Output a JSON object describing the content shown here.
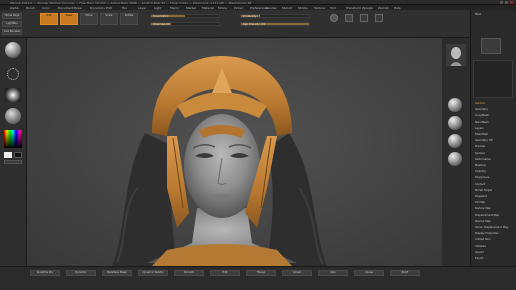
{
  "titlebar": {
    "text": "ZBrush 2021.6 — Wonder Woman (Cronos) — Free Mem 16.233 — Active Mem 3498 — Scratch Disk 53 — Timer 0.091 — PolyCount: 4.112 MP — MeshCount: 68"
  },
  "menubar": {
    "items": [
      "Alpha",
      "Brush",
      "Color",
      "Document",
      "Draw",
      "Dynamics",
      "Edit",
      "File",
      "Layer",
      "Light",
      "Macro",
      "Marker",
      "Material",
      "Movie",
      "Picker",
      "Preferences",
      "Render",
      "Stencil",
      "Stroke",
      "Texture",
      "Tool",
      "Transform",
      "Zplugin",
      "Zscript",
      "Help"
    ]
  },
  "topshelf": {
    "buttons": [
      "Home Page",
      "LightBox",
      "Live Boolean",
      "Edit",
      "Draw",
      "Move",
      "Scale",
      "Rotate"
    ],
    "sliders": [
      {
        "label": "Focal Shift 0",
        "level": 0.5
      },
      {
        "label": "Draw Size 64",
        "level": 0.3
      },
      {
        "label": "Z Intensity 25",
        "level": 0.25
      },
      {
        "label": "Rgb Intensity 100",
        "level": 1.0
      }
    ]
  },
  "rightpanel": {
    "header": "Tool",
    "items": [
      "Subtool",
      "Geometry",
      "ArrayMesh",
      "NanoMesh",
      "Layers",
      "FiberMesh",
      "Geometry HD",
      "Preview",
      "Surface",
      "Deformation",
      "Masking",
      "Visibility",
      "Polygroups",
      "Contact",
      "Morph Target",
      "Polypaint",
      "UV Map",
      "Texture Map",
      "Displacement Map",
      "Normal Map",
      "Vector Displacement Map",
      "Display Properties",
      "Unified Skin",
      "Initialize",
      "Import",
      "Export"
    ]
  },
  "bottombar": {
    "labels": [
      "Sculptris Pro",
      "Dynamic",
      "Backface Mask",
      "Dynamic Subdiv",
      "Smooth",
      "Edit",
      "Transp",
      "Ghost",
      "Solo",
      "Xpose",
      "PolyF"
    ]
  },
  "colors": {
    "accent": "#c97a1e",
    "panel": "#2e2e2e",
    "viewport": "#464646"
  }
}
